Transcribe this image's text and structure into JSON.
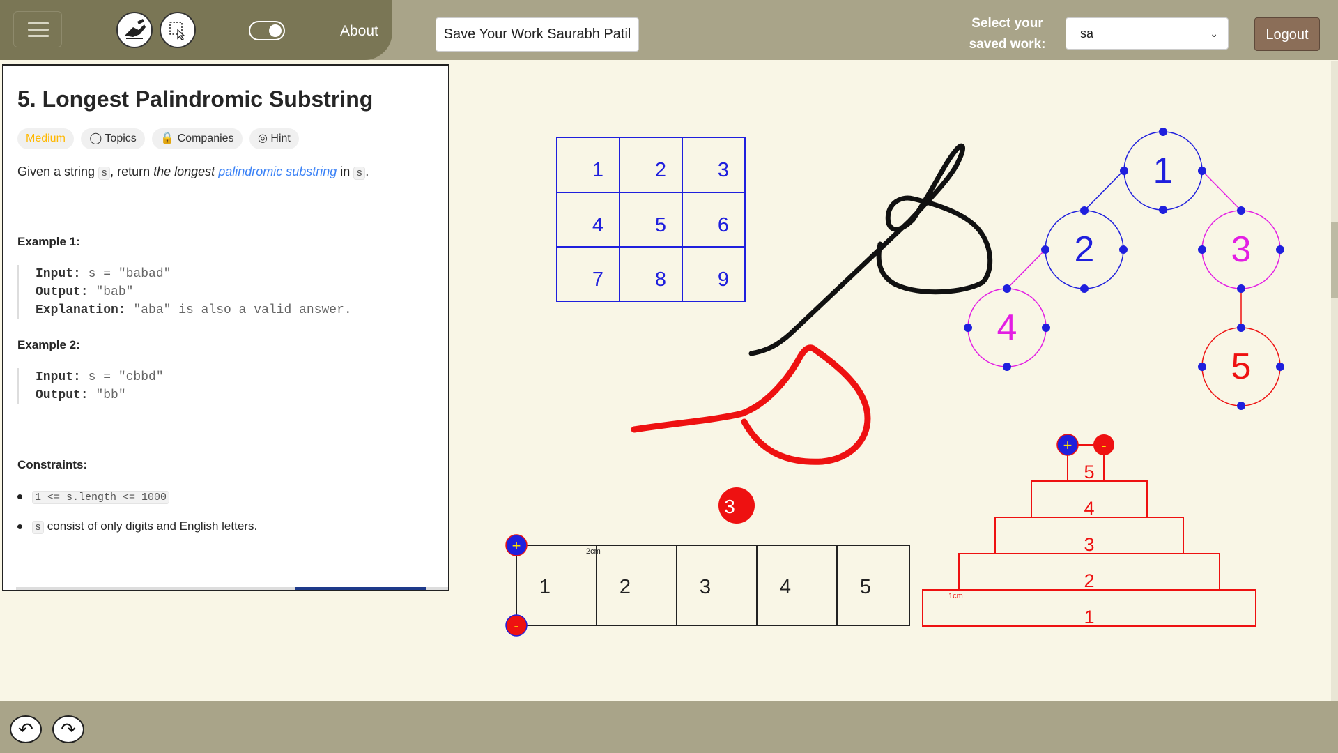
{
  "header": {
    "about_label": "About",
    "save_button_label": "Save Your Work Saurabh Patil",
    "select_label_line1": "Select your",
    "select_label_line2": "saved work:",
    "saved_work_value": "sa",
    "logout_label": "Logout"
  },
  "problem": {
    "title": "5. Longest Palindromic Substring",
    "tags": [
      "Medium",
      "Topics",
      "Companies",
      "Hint"
    ],
    "desc_prefix": "Given a string ",
    "desc_code1": "s",
    "desc_mid": ", return ",
    "desc_italic": "the longest ",
    "desc_link": "palindromic substring",
    "desc_in": " in ",
    "desc_code2": "s",
    "desc_end": ".",
    "example1_heading": "Example 1:",
    "example1_input_label": "Input:",
    "example1_input": "s = \"babad\"",
    "example1_output_label": "Output:",
    "example1_output": "\"bab\"",
    "example1_expl_label": "Explanation:",
    "example1_expl": "\"aba\" is also a valid answer.",
    "example2_heading": "Example 2:",
    "example2_input_label": "Input:",
    "example2_input": "s = \"cbbd\"",
    "example2_output_label": "Output:",
    "example2_output": "\"bb\"",
    "constraints_heading": "Constraints:",
    "constraint1": "1 <= s.length <= 1000",
    "constraint2_code": "s",
    "constraint2_text": " consist of only digits and English letters."
  },
  "canvas": {
    "matrix": [
      "1",
      "2",
      "3",
      "4",
      "5",
      "6",
      "7",
      "8",
      "9"
    ],
    "tree_nodes": [
      "1",
      "2",
      "3",
      "4",
      "5"
    ],
    "badge": "3",
    "array_cells": [
      "1",
      "2",
      "3",
      "4",
      "5"
    ],
    "array_scale_label": "2cm",
    "stack_levels": [
      "5",
      "4",
      "3",
      "2",
      "1"
    ],
    "stack_scale_label": "1cm",
    "plus_symbol": "+",
    "minus_symbol": "-"
  },
  "colors": {
    "blue": "#1f1fdd",
    "magenta": "#e31ee3",
    "red": "#ee1111",
    "topbar": "#a9a489",
    "nav": "#7a7655",
    "canvas_bg": "#f9f6e6"
  }
}
